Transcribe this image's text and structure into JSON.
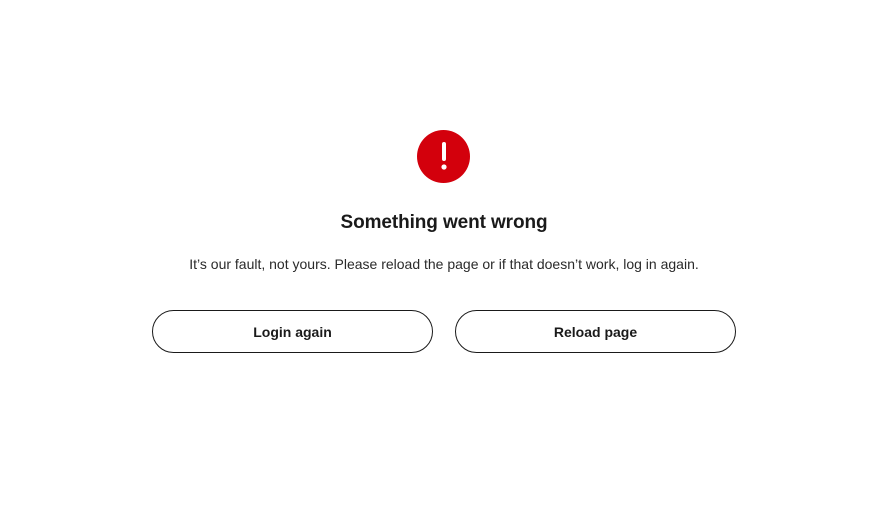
{
  "icon": {
    "name": "exclamation-icon",
    "glyph": "!",
    "color": "#d3000c"
  },
  "error": {
    "title": "Something went wrong",
    "message": "It’s our fault, not yours. Please reload the page or if that doesn’t work, log in again."
  },
  "actions": {
    "login_label": "Login again",
    "reload_label": "Reload page"
  }
}
